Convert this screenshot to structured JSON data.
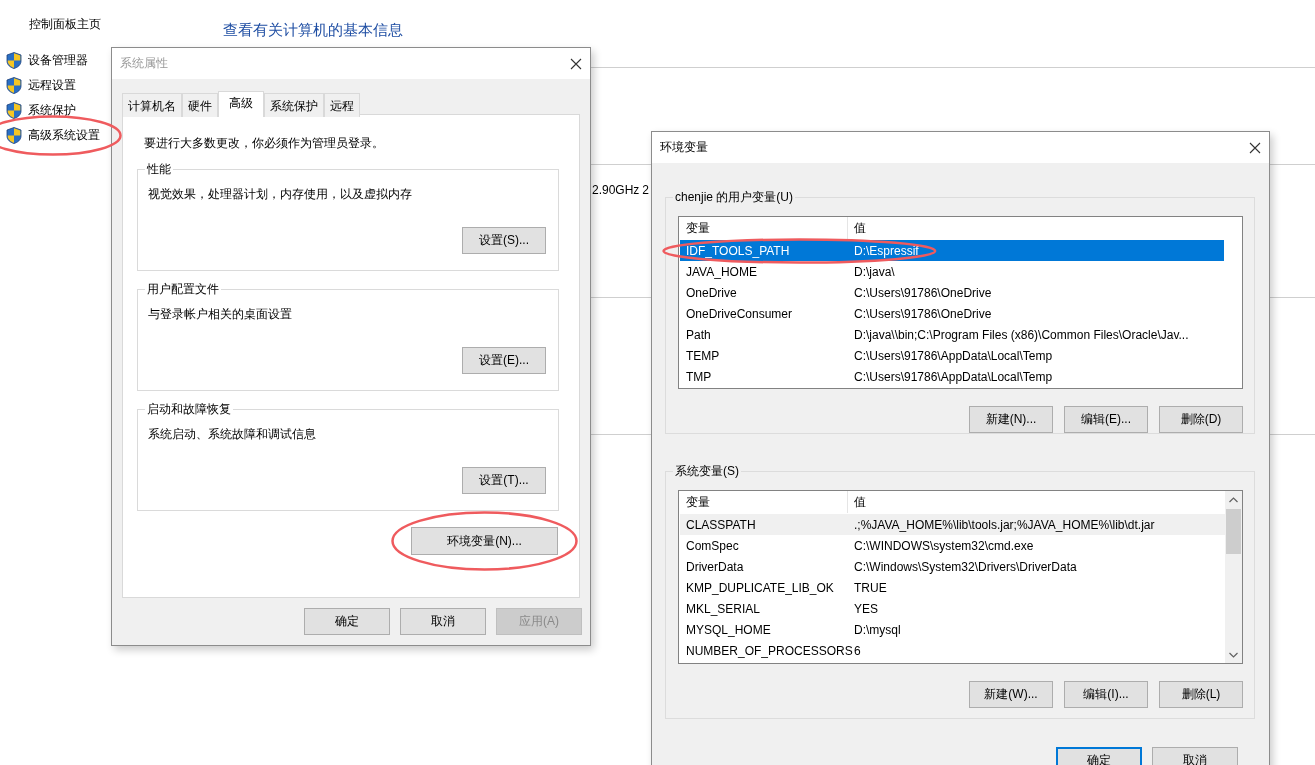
{
  "control_panel": {
    "home_link": "控制面板主页",
    "tasks": [
      {
        "label": "设备管理器",
        "circled": false
      },
      {
        "label": "远程设置",
        "circled": false
      },
      {
        "label": "系统保护",
        "circled": false
      },
      {
        "label": "高级系统设置",
        "circled": true
      }
    ],
    "heading": "查看有关计算机的基本信息",
    "visible_fragments": [
      "2.90GHz",
      "2"
    ]
  },
  "system_properties": {
    "title": "系统属性",
    "tabs": [
      {
        "label": "计算机名",
        "selected": false
      },
      {
        "label": "硬件",
        "selected": false
      },
      {
        "label": "高级",
        "selected": true
      },
      {
        "label": "系统保护",
        "selected": false
      },
      {
        "label": "远程",
        "selected": false
      }
    ],
    "notice": "要进行大多数更改，你必须作为管理员登录。",
    "groups": [
      {
        "title": "性能",
        "description": "视觉效果，处理器计划，内存使用，以及虚拟内存",
        "button": "设置(S)..."
      },
      {
        "title": "用户配置文件",
        "description": "与登录帐户相关的桌面设置",
        "button": "设置(E)..."
      },
      {
        "title": "启动和故障恢复",
        "description": "系统启动、系统故障和调试信息",
        "button": "设置(T)..."
      }
    ],
    "env_button": {
      "label": "环境变量(N)...",
      "circled": true
    },
    "buttons": [
      {
        "label": "确定",
        "disabled": false
      },
      {
        "label": "取消",
        "disabled": false
      },
      {
        "label": "应用(A)",
        "disabled": true
      }
    ]
  },
  "environment_variables": {
    "title": "环境变量",
    "user_vars": {
      "title": "chenjie 的用户变量(U)",
      "columns": [
        "变量",
        "值"
      ],
      "rows": [
        {
          "name": "IDF_TOOLS_PATH",
          "value": "D:\\Espressif",
          "selected": true,
          "highlighted": false,
          "circled": true
        },
        {
          "name": "JAVA_HOME",
          "value": "D:\\java\\",
          "selected": false,
          "highlighted": false,
          "circled": false
        },
        {
          "name": "OneDrive",
          "value": "C:\\Users\\91786\\OneDrive",
          "selected": false,
          "highlighted": false,
          "circled": false
        },
        {
          "name": "OneDriveConsumer",
          "value": "C:\\Users\\91786\\OneDrive",
          "selected": false,
          "highlighted": false,
          "circled": false
        },
        {
          "name": "Path",
          "value": "D:\\java\\\\bin;C:\\Program Files (x86)\\Common Files\\Oracle\\Jav...",
          "selected": false,
          "highlighted": false,
          "circled": false
        },
        {
          "name": "TEMP",
          "value": "C:\\Users\\91786\\AppData\\Local\\Temp",
          "selected": false,
          "highlighted": false,
          "circled": false
        },
        {
          "name": "TMP",
          "value": "C:\\Users\\91786\\AppData\\Local\\Temp",
          "selected": false,
          "highlighted": false,
          "circled": false
        }
      ],
      "buttons": [
        "新建(N)...",
        "编辑(E)...",
        "删除(D)"
      ]
    },
    "system_vars": {
      "title": "系统变量(S)",
      "columns": [
        "变量",
        "值"
      ],
      "rows": [
        {
          "name": "CLASSPATH",
          "value": ".;%JAVA_HOME%\\lib\\tools.jar;%JAVA_HOME%\\lib\\dt.jar",
          "selected": false,
          "highlighted": true,
          "circled": false
        },
        {
          "name": "ComSpec",
          "value": "C:\\WINDOWS\\system32\\cmd.exe",
          "selected": false,
          "highlighted": false,
          "circled": false
        },
        {
          "name": "DriverData",
          "value": "C:\\Windows\\System32\\Drivers\\DriverData",
          "selected": false,
          "highlighted": false,
          "circled": false
        },
        {
          "name": "KMP_DUPLICATE_LIB_OK",
          "value": "TRUE",
          "selected": false,
          "highlighted": false,
          "circled": false
        },
        {
          "name": "MKL_SERIAL",
          "value": "YES",
          "selected": false,
          "highlighted": false,
          "circled": false
        },
        {
          "name": "MYSQL_HOME",
          "value": "D:\\mysql",
          "selected": false,
          "highlighted": false,
          "circled": false
        },
        {
          "name": "NUMBER_OF_PROCESSORS",
          "value": "6",
          "selected": false,
          "highlighted": false,
          "circled": false
        }
      ],
      "buttons": [
        "新建(W)...",
        "编辑(I)...",
        "删除(L)"
      ]
    },
    "buttons": [
      {
        "label": "确定",
        "default": true
      },
      {
        "label": "取消",
        "default": false
      }
    ]
  }
}
